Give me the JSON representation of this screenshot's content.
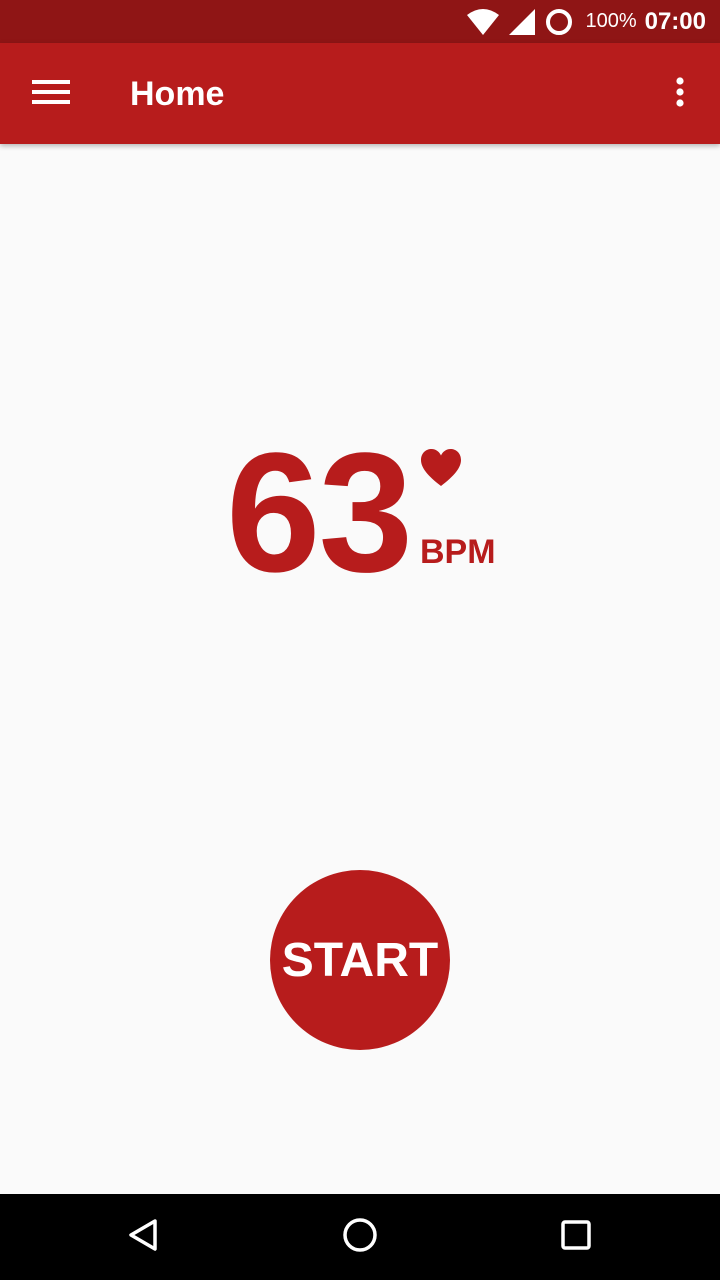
{
  "status_bar": {
    "battery_percent": "100%",
    "time": "07:00",
    "icons": [
      "wifi-icon",
      "cellular-signal-icon",
      "battery-icon"
    ]
  },
  "app_bar": {
    "title": "Home",
    "icons": [
      "menu-icon",
      "overflow-menu-icon"
    ]
  },
  "heart_rate": {
    "value": "63",
    "unit": "BPM",
    "icon": "heart-icon"
  },
  "start_button": {
    "label": "START"
  },
  "nav_bar": {
    "icons": [
      "back-icon",
      "home-icon",
      "recents-icon"
    ]
  },
  "colors": {
    "primary": "#B71C1C",
    "primary_dark": "#8F1515",
    "background": "#FAFAFA",
    "on_primary": "#FFFFFF",
    "nav_bar": "#000000"
  }
}
